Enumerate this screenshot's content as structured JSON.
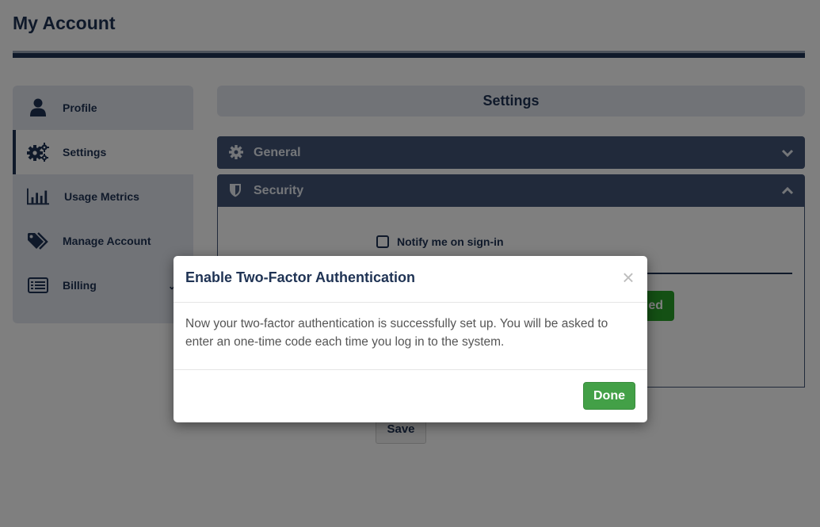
{
  "page": {
    "title": "My Account"
  },
  "sidebar": {
    "items": [
      {
        "label": "Profile",
        "icon": "user-icon",
        "active": false
      },
      {
        "label": "Settings",
        "icon": "gears-icon",
        "active": true
      },
      {
        "label": "Usage Metrics",
        "icon": "bar-chart-icon",
        "active": false
      },
      {
        "label": "Manage Account",
        "icon": "tags-icon",
        "active": false
      },
      {
        "label": "Billing",
        "icon": "list-alt-icon",
        "active": false,
        "chevron": "⌄"
      }
    ]
  },
  "settings": {
    "header": "Settings",
    "accordions": [
      {
        "label": "General",
        "icon": "gear-icon",
        "expanded": false
      },
      {
        "label": "Security",
        "icon": "shield-icon",
        "expanded": true
      }
    ],
    "security": {
      "notify_label": "Notify me on sign-in",
      "notify_checked": false,
      "enabled_button_label": "ed"
    },
    "save_label": "Save"
  },
  "modal": {
    "title": "Enable Two-Factor Authentication",
    "close_symbol": "×",
    "message": "Now your two-factor authentication is successfully set up. You will be asked to enter an one-time code each time you log in to the system.",
    "done_label": "Done"
  },
  "colors": {
    "primary": "#1f3354",
    "accordion": "#425577",
    "success": "#43a047",
    "sidebar_bg": "#e3e6ee"
  }
}
